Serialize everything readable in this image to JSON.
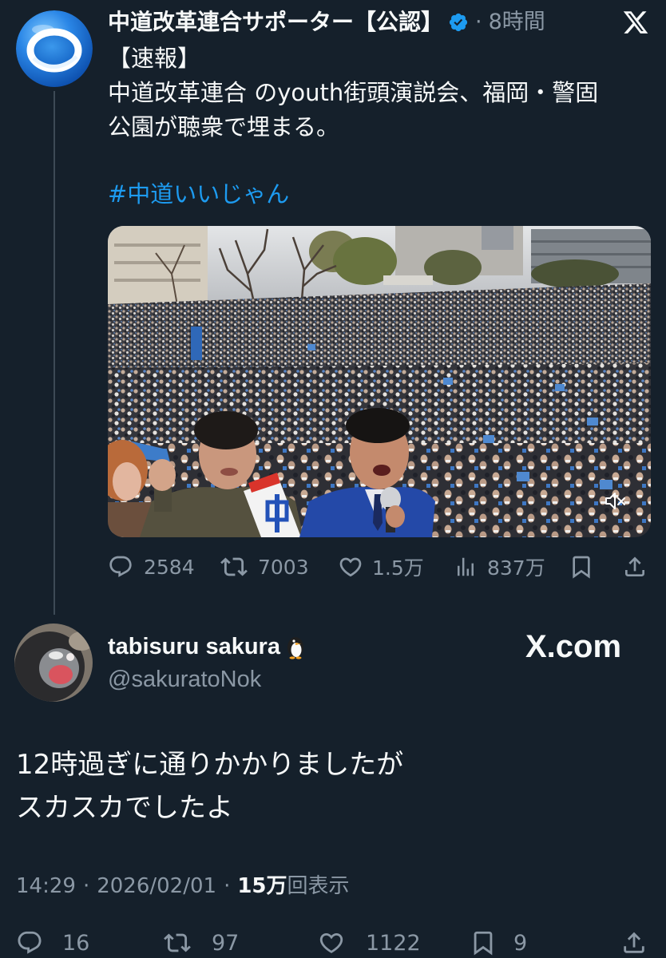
{
  "theme": {
    "background": "#15202b",
    "text": "#f7f9f9",
    "secondary_text": "#8b98a5",
    "accent": "#1d9bf0",
    "thread_line": "#3d4a56"
  },
  "top_bar": {
    "logo_icon": "x-logo-icon"
  },
  "quoted_tweet": {
    "author": {
      "display_name": "中道改革連合サポーター【公認】",
      "verified": true,
      "avatar_icon": "blue-ring-logo-icon",
      "verified_icon": "verified-badge-icon"
    },
    "separator": "·",
    "time": "8時間",
    "text_lines": [
      "【速報】",
      "中道改革連合 のyouth街頭演説会、福岡・警固",
      "公園が聴衆で埋まる。"
    ],
    "hashtag": "#中道いいじゃん",
    "media": {
      "muted": true,
      "mute_icon": "speaker-muted-icon"
    },
    "actions": {
      "replies": "2584",
      "retweets": "7003",
      "likes": "1.5万",
      "views": "837万"
    }
  },
  "reply_tweet": {
    "author": {
      "display_name": "tabisuru sakura",
      "name_emoji_icon": "penguin-emoji-icon",
      "handle": "@sakuratoNok"
    },
    "watermark": "X.com",
    "text_lines": [
      "12時過ぎに通りかかりましたが",
      "スカスカでしたよ"
    ],
    "meta": {
      "time": "14:29",
      "separator": "·",
      "date": "2026/02/01",
      "views_count": "15万",
      "views_label": "回表示"
    },
    "actions": {
      "replies": "16",
      "retweets": "97",
      "likes": "1122",
      "bookmarks": "9"
    }
  }
}
